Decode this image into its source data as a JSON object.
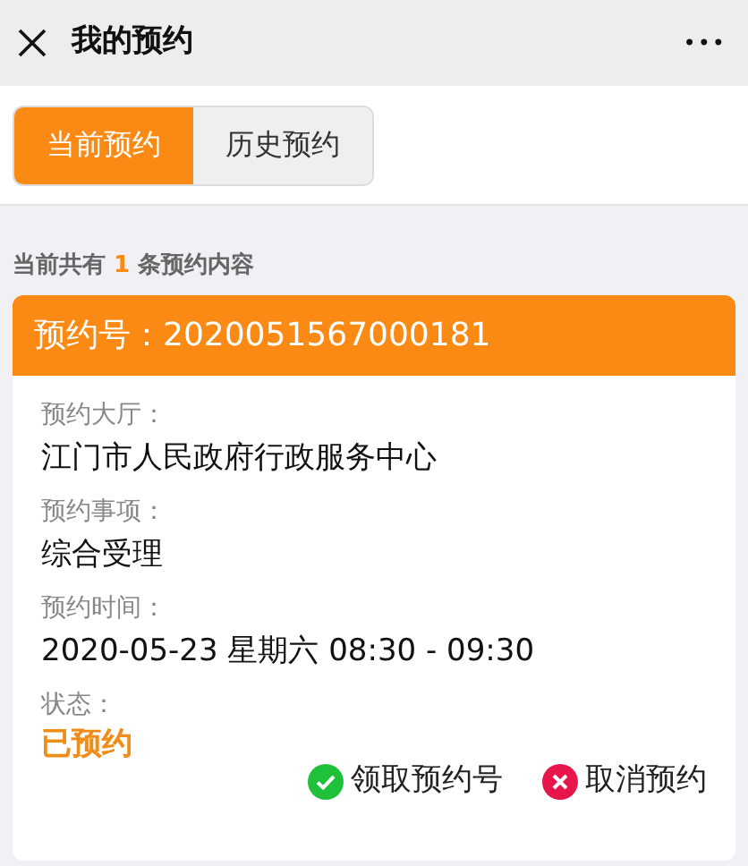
{
  "header": {
    "title": "我的预约",
    "menu": "•••"
  },
  "tabs": [
    {
      "label": "当前预约",
      "selected": true
    },
    {
      "label": "历史预约",
      "selected": false
    }
  ],
  "summary": {
    "prefix": "当前共有",
    "count": "1",
    "suffix": "条预约内容"
  },
  "card": {
    "title": "预约号：2020051567000181",
    "fields": [
      {
        "kind": "text",
        "label": "预约大厅：",
        "value": "江门市人民政府行政服务中心"
      },
      {
        "kind": "text",
        "label": "预约事项：",
        "value": "综合受理"
      },
      {
        "kind": "text",
        "label": "预约时间：",
        "value": "2020-05-23  星期六  08:30 - 09:30"
      },
      {
        "kind": "status",
        "label": "状态：",
        "value": "已预约"
      }
    ],
    "actions": [
      {
        "kind": "confirm",
        "label": "领取预约号"
      },
      {
        "kind": "cancel",
        "label": "取消预约"
      }
    ]
  }
}
